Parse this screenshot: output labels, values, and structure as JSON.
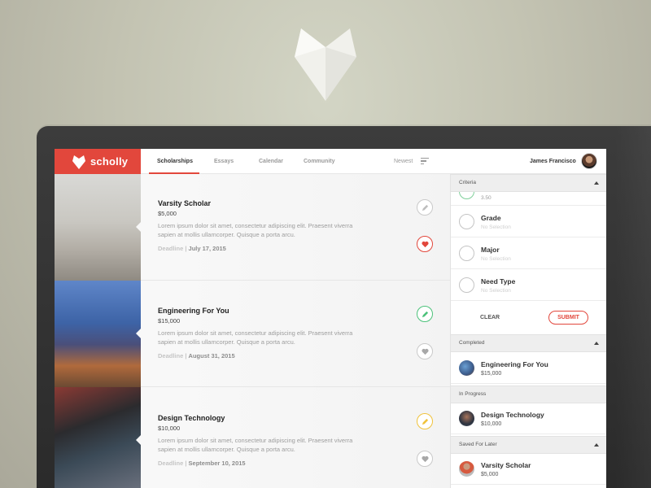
{
  "brand": {
    "name": "scholly",
    "color": "#e2473c"
  },
  "nav": {
    "tabs": [
      "Scholarships",
      "Essays",
      "Calendar",
      "Community"
    ],
    "active_tab": "Scholarships",
    "sort_label": "Newest",
    "user_name": "James Francisco"
  },
  "scholarships": [
    {
      "title": "Varsity Scholar",
      "amount": "$5,000",
      "description": "Lorem ipsum dolor sit amet, consectetur adipiscing elit. Praesent viverra sapien at mollis ullamcorper. Quisque a porta arcu.",
      "deadline_label": "Deadline",
      "deadline_date": "July 17, 2015",
      "edit_icon_color": "#bdbdbd",
      "favorite": true
    },
    {
      "title": "Engineering For You",
      "amount": "$15,000",
      "description": "Lorem ipsum dolor sit amet, consectetur adipiscing elit. Praesent viverra sapien at mollis ullamcorper. Quisque a porta arcu.",
      "deadline_label": "Deadline",
      "deadline_date": "August 31, 2015",
      "edit_icon_color": "#4cc27a",
      "favorite": false
    },
    {
      "title": "Design Technology",
      "amount": "$10,000",
      "description": "Lorem ipsum dolor sit amet, consectetur adipiscing elit. Praesent viverra sapien at mollis ullamcorper. Quisque a porta arcu.",
      "deadline_label": "Deadline",
      "deadline_date": "September 10, 2015",
      "edit_icon_color": "#f0c23a",
      "favorite": false
    }
  ],
  "sidebar": {
    "criteria_header": "Criteria",
    "partial_value": "3.50",
    "criteria": [
      {
        "label": "Grade",
        "value": "No Selection"
      },
      {
        "label": "Major",
        "value": "No Selection"
      },
      {
        "label": "Need Type",
        "value": "No Selection"
      }
    ],
    "clear_label": "CLEAR",
    "submit_label": "SUBMIT",
    "completed_header": "Completed",
    "completed": {
      "title": "Engineering For You",
      "amount": "$15,000"
    },
    "in_progress_header": "In Progress",
    "in_progress": {
      "title": "Design Technology",
      "amount": "$10,000"
    },
    "saved_header": "Saved For Later",
    "saved": {
      "title": "Varsity Scholar",
      "amount": "$5,000"
    }
  }
}
